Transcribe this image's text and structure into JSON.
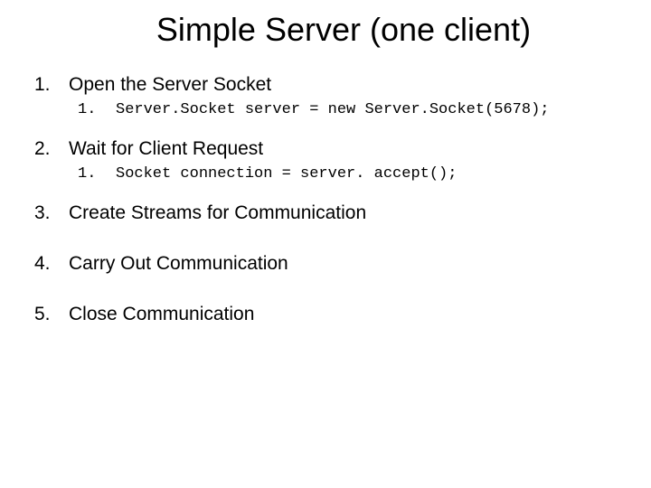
{
  "title": "Simple Server (one client)",
  "items": [
    {
      "num": "1.",
      "text": "Open the Server Socket",
      "sub": {
        "num": "1.",
        "code": "Server.Socket server = new Server.Socket(5678);"
      }
    },
    {
      "num": "2.",
      "text": "Wait for Client Request",
      "sub": {
        "num": "1.",
        "code": "Socket connection = server. accept();"
      }
    },
    {
      "num": "3.",
      "text": "Create Streams for Communication",
      "sub": null
    },
    {
      "num": "4.",
      "text": "Carry Out Communication",
      "sub": null
    },
    {
      "num": "5.",
      "text": "Close Communication",
      "sub": null
    }
  ]
}
